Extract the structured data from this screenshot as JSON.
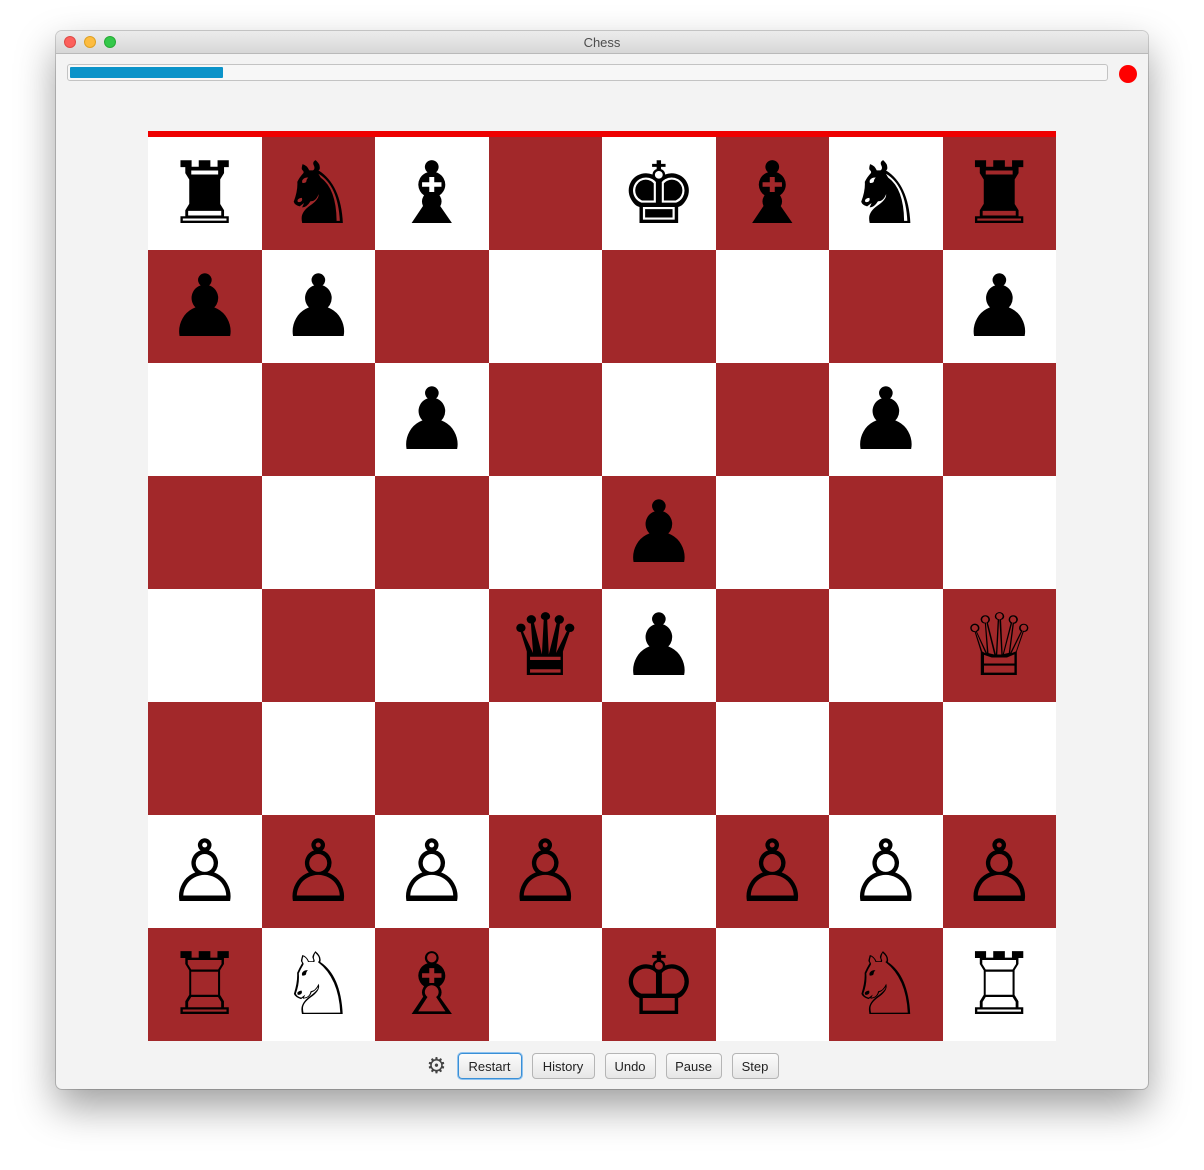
{
  "window": {
    "title": "Chess"
  },
  "progress": {
    "value": 0.148,
    "color": "#0b93c9"
  },
  "indicator": {
    "color": "#ff0000",
    "name": "record-icon"
  },
  "board": {
    "light_color": "#ffffff",
    "dark_color": "#a2282a",
    "top_edge_color": "#ee0000",
    "rows": [
      [
        "br",
        "bn",
        "bb",
        "",
        "bk",
        "bb",
        "bn",
        "br"
      ],
      [
        "bp",
        "bp",
        "",
        "",
        "",
        "",
        "",
        "bp"
      ],
      [
        "",
        "",
        "bp",
        "",
        "",
        "",
        "bp",
        ""
      ],
      [
        "",
        "",
        "",
        "",
        "bp",
        "",
        "",
        ""
      ],
      [
        "",
        "",
        "",
        "bq",
        "bp",
        "",
        "",
        "wq"
      ],
      [
        "",
        "",
        "",
        "",
        "",
        "",
        "",
        ""
      ],
      [
        "wp",
        "wp",
        "wp",
        "wp",
        "",
        "wp",
        "wp",
        "wp"
      ],
      [
        "wr",
        "wn",
        "wb",
        "",
        "wk",
        "",
        "wn",
        "wr"
      ]
    ]
  },
  "pieces": {
    "wk": "♔",
    "wq": "♕",
    "wr": "♖",
    "wb": "♗",
    "wn": "♘",
    "wp": "♙",
    "bk": "♚",
    "bq": "♛",
    "br": "♜",
    "bb": "♝",
    "bn": "♞",
    "bp": "♟"
  },
  "controls": {
    "settings_icon": "gear-icon",
    "restart_label": "Restart",
    "history_label": "History",
    "undo_label": "Undo",
    "pause_label": "Pause",
    "step_label": "Step"
  }
}
